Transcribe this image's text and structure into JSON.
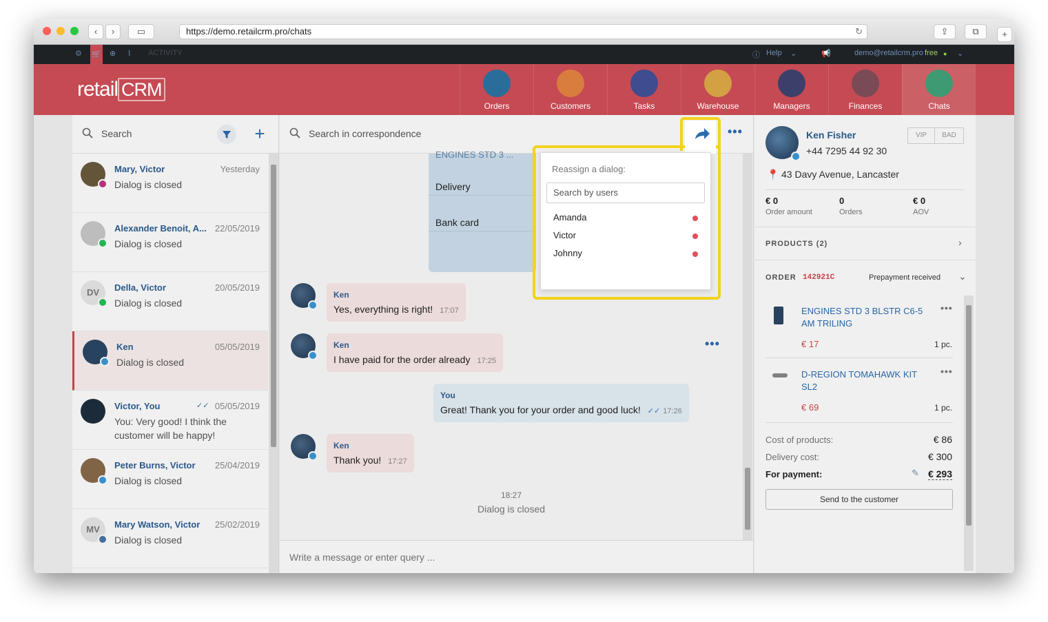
{
  "browser": {
    "url": "https://demo.retailcrm.pro/chats"
  },
  "topbar": {
    "activity": "ACTIVITY",
    "help": "Help",
    "account": "demo@retailcrm.pro",
    "plan": "free"
  },
  "brand": {
    "logo_text": "retail",
    "logo_crm": "CRM"
  },
  "nav": [
    {
      "label": "Orders",
      "icon": "cart-icon"
    },
    {
      "label": "Customers",
      "icon": "customer-icon"
    },
    {
      "label": "Tasks",
      "icon": "tasks-icon"
    },
    {
      "label": "Warehouse",
      "icon": "box-icon"
    },
    {
      "label": "Managers",
      "icon": "manager-icon"
    },
    {
      "label": "Finances",
      "icon": "finance-icon"
    },
    {
      "label": "Chats",
      "icon": "chat-icon"
    }
  ],
  "left": {
    "search_placeholder": "Search",
    "chats": [
      {
        "name": "Mary, Victor",
        "date": "Yesterday",
        "status": "Dialog is closed",
        "channel": "instagram"
      },
      {
        "name": "Alexander Benoit, A...",
        "date": "22/05/2019",
        "status": "Dialog is closed",
        "channel": "whatsapp"
      },
      {
        "name": "Della, Victor",
        "date": "20/05/2019",
        "status": "Dialog is closed",
        "channel": "whatsapp",
        "initials": "DV"
      },
      {
        "name": "Ken",
        "date": "05/05/2019",
        "status": "Dialog is closed",
        "channel": "telegram"
      },
      {
        "name": "Victor, You",
        "date": "05/05/2019",
        "status": "You: Very good! I think the customer will be happy!",
        "channel": "none"
      },
      {
        "name": "Peter Burns, Victor",
        "date": "25/04/2019",
        "status": "Dialog is closed",
        "channel": "telegram"
      },
      {
        "name": "Mary Watson, Victor",
        "date": "25/02/2019",
        "status": "Dialog is closed",
        "channel": "vk",
        "initials": "MV"
      }
    ]
  },
  "middle": {
    "search_placeholder": "Search in correspondence",
    "order_card": {
      "partial_line": "ENGINES STD 3 ...",
      "delivery": "Delivery",
      "payment": "Bank card"
    },
    "messages": [
      {
        "from": "Ken",
        "text": "Yes, everything is right!",
        "time": "17:07"
      },
      {
        "from": "Ken",
        "text": "I have paid for the order already",
        "time": "17:25"
      },
      {
        "from": "You",
        "text": "Great! Thank you for your order and good luck!",
        "time": "17:26"
      },
      {
        "from": "Ken",
        "text": "Thank you!",
        "time": "17:27"
      }
    ],
    "closed_time": "18:27",
    "closed_text": "Dialog is closed",
    "compose_placeholder": "Write a message or enter query ..."
  },
  "reassign": {
    "title": "Reassign a dialog:",
    "search_placeholder": "Search by users",
    "users": [
      "Amanda",
      "Victor",
      "Johnny"
    ]
  },
  "customer": {
    "name": "Ken Fisher",
    "phone": "+44 7295 44 92 30",
    "address": "43 Davy Avenue, Lancaster",
    "tags": [
      "VIP",
      "BAD"
    ],
    "stats": [
      {
        "value": "€ 0",
        "label": "Order amount"
      },
      {
        "value": "0",
        "label": "Orders"
      },
      {
        "value": "€ 0",
        "label": "AOV"
      }
    ],
    "products_header": "PRODUCTS (2)",
    "order_label": "ORDER",
    "order_number": "142921C",
    "order_status": "Prepayment received",
    "items": [
      {
        "title": "ENGINES STD 3 BLSTR C6-5 AM TRILING",
        "price": "€ 17",
        "qty": "1 pc."
      },
      {
        "title": "D-REGION TOMAHAWK KIT SL2",
        "price": "€ 69",
        "qty": "1 pc."
      }
    ],
    "cost_label": "Cost of products:",
    "cost_value": "€ 86",
    "delivery_label": "Delivery cost:",
    "delivery_value": "€ 300",
    "payment_label": "For payment:",
    "payment_value": "€ 293",
    "send_button": "Send to the customer"
  },
  "colors": {
    "brand_red": "#c54a53",
    "link_blue": "#2c5f93",
    "highlight": "#f4d21b"
  }
}
